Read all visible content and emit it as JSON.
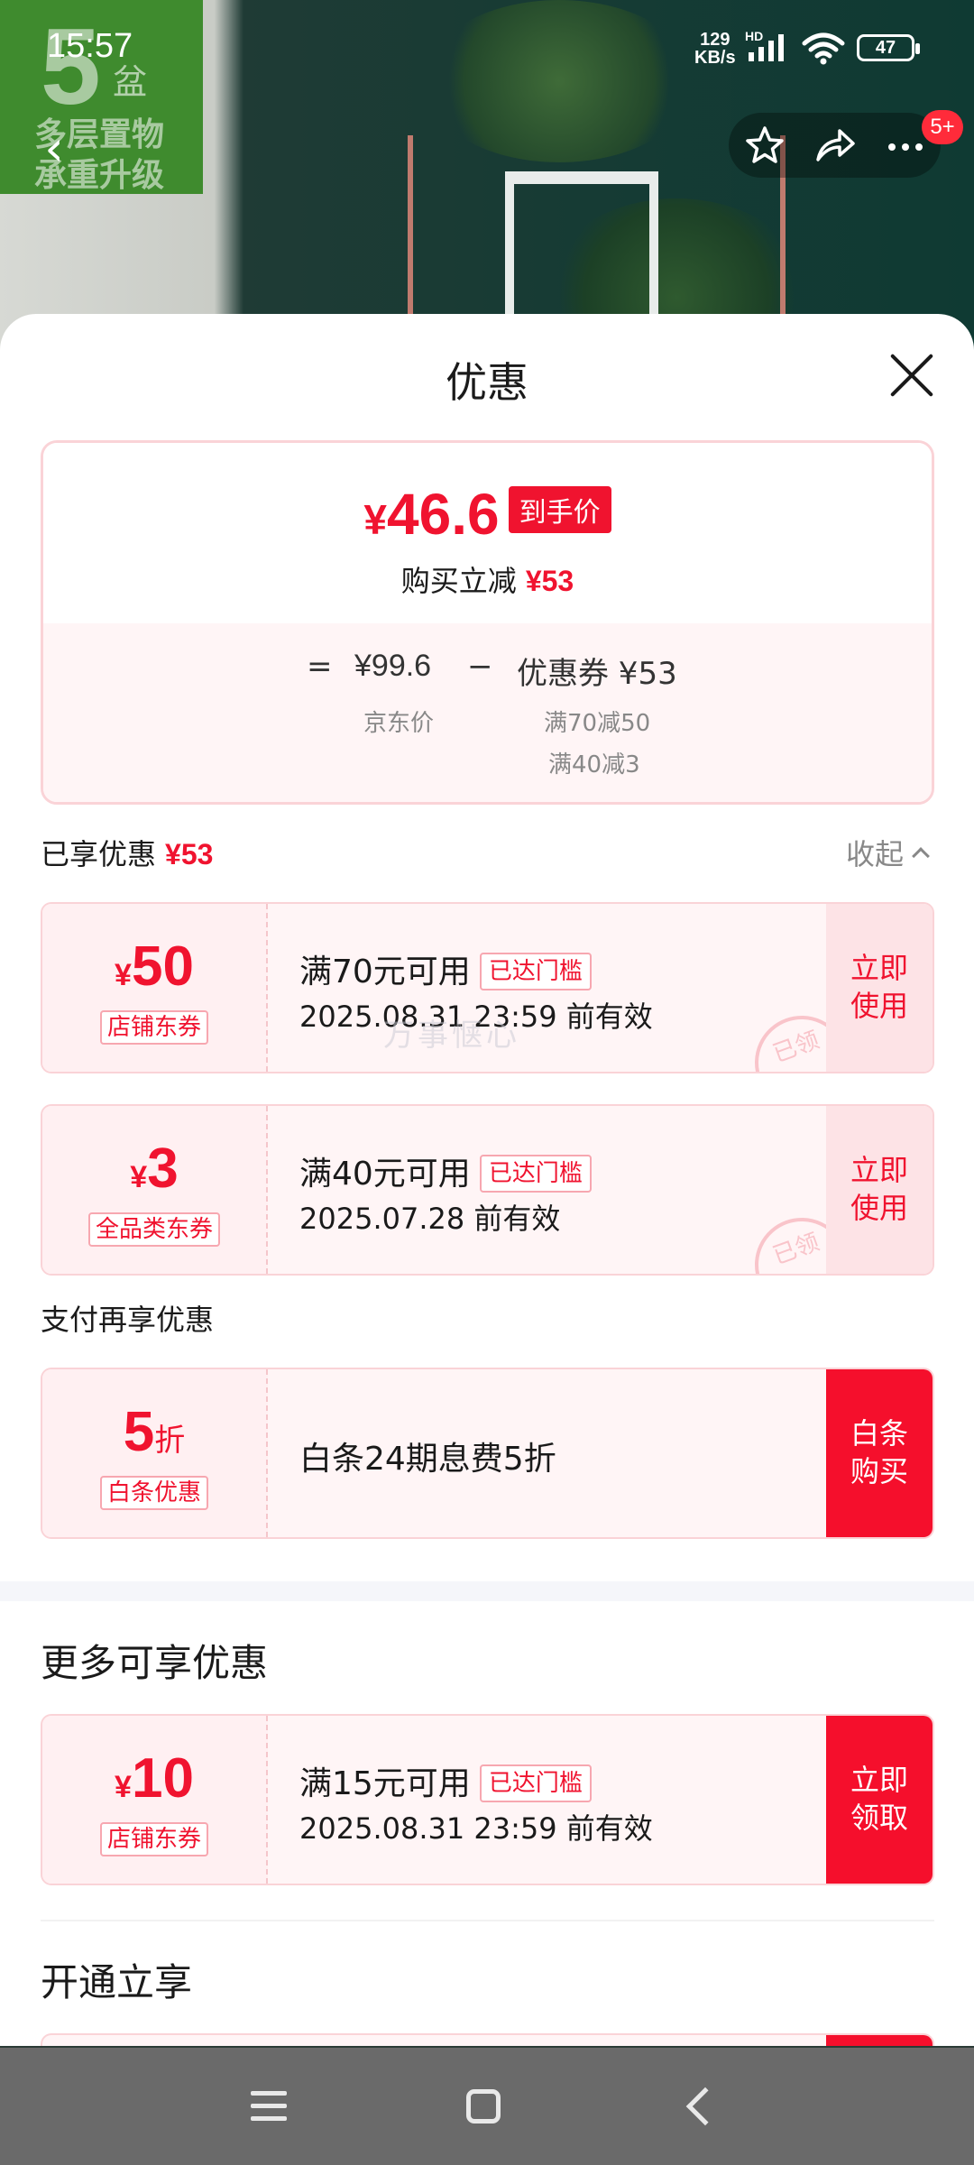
{
  "status_bar": {
    "time": "15:57",
    "net_speed_value": "129",
    "net_speed_unit": "KB/s",
    "hd": "HD",
    "battery": "47"
  },
  "background": {
    "big_number": "5",
    "unit": "盆",
    "line1": "多层置物",
    "line2": "承重升级"
  },
  "top_actions": {
    "badge": "5+"
  },
  "sheet": {
    "title": "优惠",
    "summary": {
      "currency": "¥",
      "final_price": "46.6",
      "final_tag": "到手价",
      "save_label": "购买立减",
      "save_amount": "¥53",
      "eq": "=",
      "original_price": "¥99.6",
      "minus": "−",
      "coupon_total": "优惠券 ¥53",
      "original_label": "京东价",
      "coupon_rule_1": "满70减50",
      "coupon_rule_2": "满40减3"
    },
    "enjoyed": {
      "label": "已享优惠",
      "amount": "¥53",
      "collapse": "收起"
    },
    "coupons": [
      {
        "currency": "¥",
        "value": "50",
        "kind": "店铺东券",
        "condition": "满70元可用",
        "threshold": "已达门槛",
        "expiry": "2025.08.31 23:59 前有效",
        "action_line1": "立即",
        "action_line2": "使用",
        "stamp": "已领",
        "watermark": "万事惬心"
      },
      {
        "currency": "¥",
        "value": "3",
        "kind": "全品类东券",
        "condition": "满40元可用",
        "threshold": "已达门槛",
        "expiry": "2025.07.28 前有效",
        "action_line1": "立即",
        "action_line2": "使用",
        "stamp": "已领"
      }
    ],
    "pay_section_label": "支付再享优惠",
    "pay_offer": {
      "value": "5",
      "unit": "折",
      "kind": "白条优惠",
      "desc": "白条24期息费5折",
      "action_line1": "白条",
      "action_line2": "购买"
    },
    "more_title": "更多可享优惠",
    "more_coupon": {
      "currency": "¥",
      "value": "10",
      "kind": "店铺东券",
      "condition": "满15元可用",
      "threshold": "已达门槛",
      "expiry": "2025.08.31 23:59 前有效",
      "action_line1": "立即",
      "action_line2": "领取"
    },
    "open_title": "开通立享"
  },
  "colors": {
    "accent": "#f0132f",
    "coupon_bg": "#fff5f6",
    "border": "#fad3d7"
  }
}
